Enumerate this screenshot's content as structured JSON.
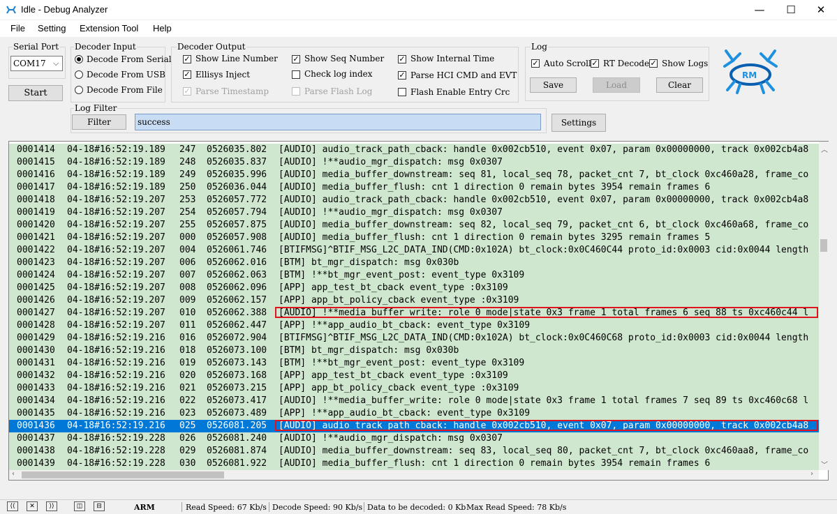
{
  "window": {
    "title": "Idle - Debug Analyzer",
    "controls": {
      "minimize": "—",
      "maximize": "☐",
      "close": "✕"
    }
  },
  "menu": [
    "File",
    "Setting",
    "Extension Tool",
    "Help"
  ],
  "serial_port": {
    "label": "Serial Port",
    "value": "COM17",
    "start_label": "Start"
  },
  "decoder_input": {
    "label": "Decoder Input",
    "options": [
      "Decode From Serial",
      "Decode From USB",
      "Decode From File"
    ],
    "selected": 0
  },
  "decoder_output": {
    "label": "Decoder Output",
    "show_line_number": "Show Line Number",
    "ellisys_inject": "Ellisys Inject",
    "parse_timestamp": "Parse Timestamp",
    "show_seq_number": "Show Seq Number",
    "check_log_index": "Check log index",
    "parse_flash_log": "Parse Flash Log",
    "show_internal_time": "Show Internal Time",
    "parse_hci": "Parse HCI CMD and EVT",
    "flash_enable": "Flash Enable Entry Crc"
  },
  "log": {
    "label": "Log",
    "auto_scroll": "Auto Scroll",
    "rt_decode": "RT Decode",
    "show_logs": "Show Logs",
    "save": "Save",
    "load": "Load",
    "clear": "Clear"
  },
  "log_filter": {
    "label": "Log Filter",
    "button": "Filter",
    "value": "success",
    "settings": "Settings"
  },
  "colors": {
    "row_bg": "#cfe7cf",
    "selected_bg": "#0078d7",
    "highlight_border": "#e0141e"
  },
  "rows": [
    {
      "line": "0001414",
      "time": "04-18#16:52:19.189",
      "seq": "247",
      "itime": "0526035.802",
      "msg": "[AUDIO] audio_track_path_cback: handle 0x002cb510, event 0x07, param 0x00000000, track 0x002cb4a8"
    },
    {
      "line": "0001415",
      "time": "04-18#16:52:19.189",
      "seq": "248",
      "itime": "0526035.837",
      "msg": "[AUDIO] !**audio_mgr_dispatch: msg 0x0307"
    },
    {
      "line": "0001416",
      "time": "04-18#16:52:19.189",
      "seq": "249",
      "itime": "0526035.996",
      "msg": "[AUDIO] media_buffer_downstream: seq 81, local_seq 78, packet_cnt 7, bt_clock 0xc460a28, frame_co"
    },
    {
      "line": "0001417",
      "time": "04-18#16:52:19.189",
      "seq": "250",
      "itime": "0526036.044",
      "msg": "[AUDIO] media_buffer_flush: cnt 1 direction 0 remain bytes 3954 remain frames 6"
    },
    {
      "line": "0001418",
      "time": "04-18#16:52:19.207",
      "seq": "253",
      "itime": "0526057.772",
      "msg": "[AUDIO] audio_track_path_cback: handle 0x002cb510, event 0x07, param 0x00000000, track 0x002cb4a8"
    },
    {
      "line": "0001419",
      "time": "04-18#16:52:19.207",
      "seq": "254",
      "itime": "0526057.794",
      "msg": "[AUDIO] !**audio_mgr_dispatch: msg 0x0307"
    },
    {
      "line": "0001420",
      "time": "04-18#16:52:19.207",
      "seq": "255",
      "itime": "0526057.875",
      "msg": "[AUDIO] media_buffer_downstream: seq 82, local_seq 79, packet_cnt 6, bt_clock 0xc460a68, frame_co"
    },
    {
      "line": "0001421",
      "time": "04-18#16:52:19.207",
      "seq": "000",
      "itime": "0526057.908",
      "msg": "[AUDIO] media_buffer_flush: cnt 1 direction 0 remain bytes 3295 remain frames 5"
    },
    {
      "line": "0001422",
      "time": "04-18#16:52:19.207",
      "seq": "004",
      "itime": "0526061.746",
      "msg": "[BTIFMSG]^BTIF_MSG_L2C_DATA_IND(CMD:0x102A) bt_clock:0x0C460C44 proto_id:0x0003 cid:0x0044 length"
    },
    {
      "line": "0001423",
      "time": "04-18#16:52:19.207",
      "seq": "006",
      "itime": "0526062.016",
      "msg": "[BTM] bt_mgr_dispatch: msg 0x030b"
    },
    {
      "line": "0001424",
      "time": "04-18#16:52:19.207",
      "seq": "007",
      "itime": "0526062.063",
      "msg": "[BTM] !**bt_mgr_event_post: event_type 0x3109"
    },
    {
      "line": "0001425",
      "time": "04-18#16:52:19.207",
      "seq": "008",
      "itime": "0526062.096",
      "msg": "[APP] app_test_bt_cback event_type :0x3109"
    },
    {
      "line": "0001426",
      "time": "04-18#16:52:19.207",
      "seq": "009",
      "itime": "0526062.157",
      "msg": "[APP] app_bt_policy_cback event_type :0x3109"
    },
    {
      "line": "0001427",
      "time": "04-18#16:52:19.207",
      "seq": "010",
      "itime": "0526062.388",
      "msg": "[AUDIO] !**media_buffer_write: role 0 mode|state 0x3 frame 1 total frames 6 seq 88 ts 0xc460c44 l",
      "hl": true
    },
    {
      "line": "0001428",
      "time": "04-18#16:52:19.207",
      "seq": "011",
      "itime": "0526062.447",
      "msg": "[APP] !**app_audio_bt_cback: event_type 0x3109"
    },
    {
      "line": "0001429",
      "time": "04-18#16:52:19.216",
      "seq": "016",
      "itime": "0526072.904",
      "msg": "[BTIFMSG]^BTIF_MSG_L2C_DATA_IND(CMD:0x102A) bt_clock:0x0C460C68 proto_id:0x0003 cid:0x0044 length"
    },
    {
      "line": "0001430",
      "time": "04-18#16:52:19.216",
      "seq": "018",
      "itime": "0526073.100",
      "msg": "[BTM] bt_mgr_dispatch: msg 0x030b"
    },
    {
      "line": "0001431",
      "time": "04-18#16:52:19.216",
      "seq": "019",
      "itime": "0526073.143",
      "msg": "[BTM] !**bt_mgr_event_post: event_type 0x3109"
    },
    {
      "line": "0001432",
      "time": "04-18#16:52:19.216",
      "seq": "020",
      "itime": "0526073.168",
      "msg": "[APP] app_test_bt_cback event_type :0x3109"
    },
    {
      "line": "0001433",
      "time": "04-18#16:52:19.216",
      "seq": "021",
      "itime": "0526073.215",
      "msg": "[APP] app_bt_policy_cback event_type :0x3109"
    },
    {
      "line": "0001434",
      "time": "04-18#16:52:19.216",
      "seq": "022",
      "itime": "0526073.417",
      "msg": "[AUDIO] !**media_buffer_write: role 0 mode|state 0x3 frame 1 total frames 7 seq 89 ts 0xc460c68 l"
    },
    {
      "line": "0001435",
      "time": "04-18#16:52:19.216",
      "seq": "023",
      "itime": "0526073.489",
      "msg": "[APP] !**app_audio_bt_cback: event_type 0x3109"
    },
    {
      "line": "0001436",
      "time": "04-18#16:52:19.216",
      "seq": "025",
      "itime": "0526081.205",
      "msg": "[AUDIO] audio_track_path_cback: handle 0x002cb510, event 0x07, param 0x00000000, track 0x002cb4a8",
      "hl": true,
      "sel": true
    },
    {
      "line": "0001437",
      "time": "04-18#16:52:19.228",
      "seq": "026",
      "itime": "0526081.240",
      "msg": "[AUDIO] !**audio_mgr_dispatch: msg 0x0307"
    },
    {
      "line": "0001438",
      "time": "04-18#16:52:19.228",
      "seq": "029",
      "itime": "0526081.874",
      "msg": "[AUDIO] media_buffer_downstream: seq 83, local_seq 80, packet_cnt 7, bt_clock 0xc460aa8, frame_co"
    },
    {
      "line": "0001439",
      "time": "04-18#16:52:19.228",
      "seq": "030",
      "itime": "0526081.922",
      "msg": "[AUDIO] media_buffer_flush: cnt 1 direction 0 remain bytes 3954 remain frames 6"
    }
  ],
  "status": {
    "arch": "ARM",
    "read_speed": "Read Speed:  67 Kb/s",
    "decode_speed": "Decode Speed:  90 Kb/s",
    "to_decode": "Data to be decoded:  0 Kb",
    "max_read": "Max Read Speed:  78 Kb/s"
  }
}
